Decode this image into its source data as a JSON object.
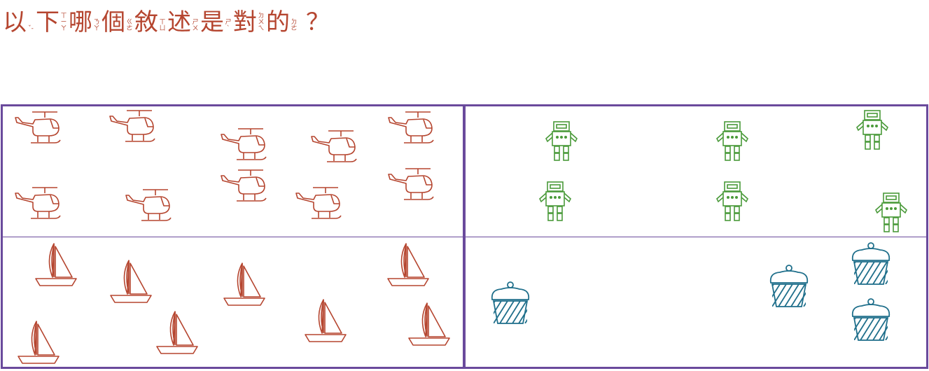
{
  "question": {
    "chars": [
      {
        "han": "以",
        "bpmf": "ˇ-"
      },
      {
        "han": "下",
        "bpmf": "ㄒ\nㄧ\nㄚ"
      },
      {
        "han": "哪",
        "bpmf": "ㄋ\nㄚ"
      },
      {
        "han": "個",
        "bpmf": "ㄍ\nㄜ"
      },
      {
        "han": "敘",
        "bpmf": "ㄒ\nㄩ"
      },
      {
        "han": "述",
        "bpmf": "ㄕ\nㄨ"
      },
      {
        "han": "是",
        "bpmf": "ㄕ\n`"
      },
      {
        "han": "對",
        "bpmf": "ㄉ\nㄨ\nㄟ"
      },
      {
        "han": "的",
        "bpmf": "ㄉ\nㄜ"
      }
    ],
    "mark": "？"
  },
  "colors": {
    "frame": "#6a4a9c",
    "helicopter": "#b5452f",
    "sailboat": "#b5452f",
    "robot": "#4a9a3a",
    "cupcake": "#1f6f8b"
  },
  "groups": {
    "helicopters": {
      "icon": "helicopter-icon",
      "count": 10
    },
    "robots": {
      "icon": "robot-icon",
      "count": 6
    },
    "sailboats": {
      "icon": "sailboat-icon",
      "count": 8
    },
    "cupcakes": {
      "icon": "cupcake-icon",
      "count": 4
    }
  }
}
